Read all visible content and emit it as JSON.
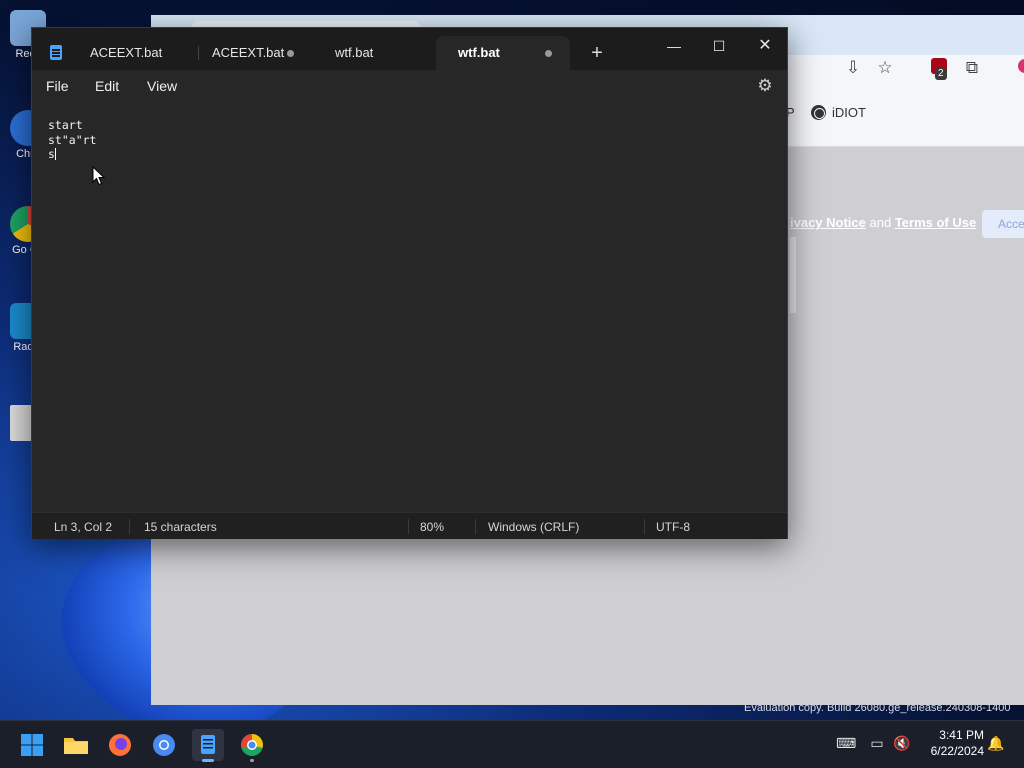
{
  "desktop": {
    "icons": [
      {
        "label": "Recy",
        "color": "#7aa6d8"
      },
      {
        "label": "Chro",
        "color": "#2b6fd6"
      },
      {
        "label": "Go Ch",
        "color": "#e0463a"
      },
      {
        "label": "Radm",
        "color": "#1a8ccd"
      },
      {
        "label": "",
        "color": "#dcdcdc"
      }
    ],
    "watermark": "Evaluation copy. Build 26080.ge_release.240308-1400"
  },
  "browser": {
    "bookmark_label": "P",
    "bookmark_idiot": "iDIOT",
    "legal_prefix": "ivacy Notice",
    "legal_and": "and",
    "legal_terms": "Terms of Use",
    "accept_label": "Acce",
    "extension_badge": "2"
  },
  "notepad": {
    "tabs": [
      {
        "label": "ACEEXT.bat",
        "modified": false,
        "active": false
      },
      {
        "label": "ACEEXT.bat",
        "modified": true,
        "active": false
      },
      {
        "label": "wtf.bat",
        "modified": false,
        "active": false
      },
      {
        "label": "wtf.bat",
        "modified": true,
        "active": true
      }
    ],
    "new_tab_symbol": "+",
    "window_controls": {
      "minimize": "—",
      "maximize": "☐",
      "close": "✕"
    },
    "menu": {
      "file": "File",
      "edit": "Edit",
      "view": "View"
    },
    "content_lines": [
      "start",
      "st\"a\"rt",
      "s"
    ],
    "status": {
      "position": "Ln 3, Col 2",
      "characters": "15 characters",
      "zoom": "80%",
      "line_endings": "Windows (CRLF)",
      "encoding": "UTF-8"
    }
  },
  "taskbar": {
    "apps": [
      "start-button",
      "file-explorer",
      "firefox",
      "chromium",
      "notepad",
      "chrome"
    ],
    "time": "3:41 PM",
    "date": "6/22/2024"
  }
}
